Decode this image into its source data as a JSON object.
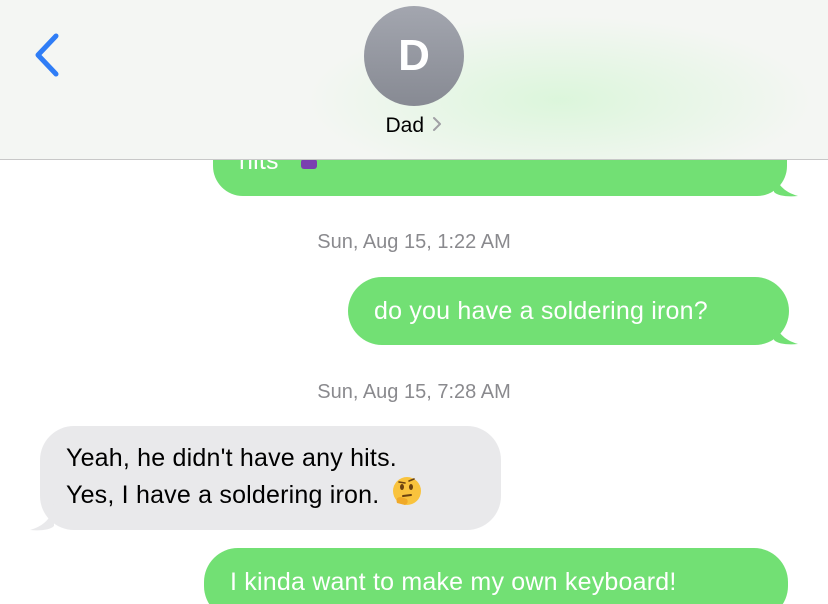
{
  "header": {
    "avatar_initial": "D",
    "contact_name": "Dad"
  },
  "messages": {
    "partial_sent_text": "hits",
    "timestamp_1": "Sun, Aug 15, 1:22 AM",
    "sent_1": "do you have a soldering iron?",
    "timestamp_2": "Sun, Aug 15, 7:28 AM",
    "received_line_1": "Yeah, he didn't have any hits.",
    "received_line_2": "Yes, I have a soldering iron.",
    "sent_2": "I kinda want to make my own keyboard!"
  },
  "colors": {
    "sent_bubble": "#72e074",
    "received_bubble": "#e9e9eb",
    "accent_blue": "#2f7df6",
    "timestamp_gray": "#8a8a8e"
  },
  "icons": {
    "back": "chevron-left-icon",
    "contact_chevron": "chevron-right-icon",
    "emoji_1": "woman-facepalming-emoji",
    "emoji_2": "thinking-face-emoji"
  }
}
